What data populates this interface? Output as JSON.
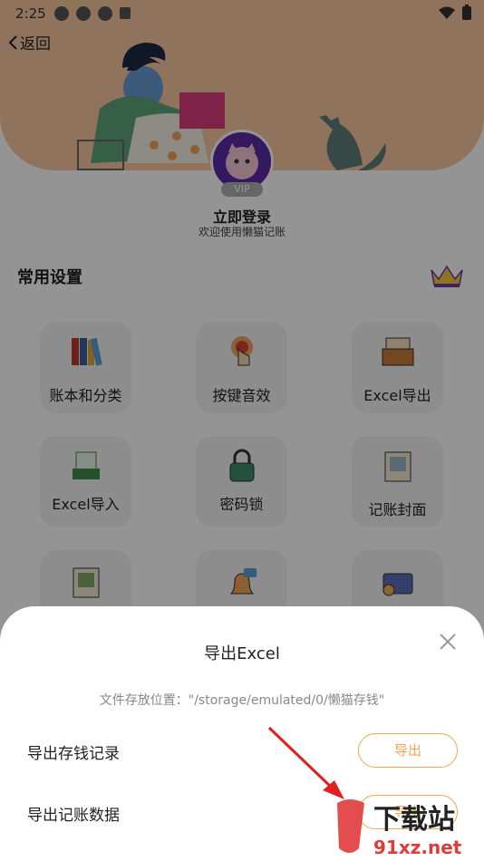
{
  "status_bar": {
    "time": "2:25"
  },
  "header": {
    "back_label": "返回"
  },
  "profile": {
    "vip_badge": "VIP",
    "login_title": "立即登录",
    "login_subtitle": "欢迎使用懒猫记账"
  },
  "settings": {
    "section_title": "常用设置",
    "items": [
      {
        "label": "账本和分类",
        "icon": "books-icon"
      },
      {
        "label": "按键音效",
        "icon": "touch-sound-icon"
      },
      {
        "label": "Excel导出",
        "icon": "export-drawer-icon"
      },
      {
        "label": "Excel导入",
        "icon": "xls-import-icon"
      },
      {
        "label": "密码锁",
        "icon": "padlock-icon"
      },
      {
        "label": "记账封面",
        "icon": "picture-frame-icon"
      }
    ]
  },
  "sheet": {
    "title": "导出Excel",
    "path_text": "文件存放位置：\"/storage/emulated/0/懒猫存钱\"",
    "rows": [
      {
        "label": "导出存钱记录",
        "button": "导出"
      },
      {
        "label": "导出记账数据",
        "button": "导出"
      }
    ]
  },
  "watermark": {
    "brand": "下载站",
    "site": "91xz.net"
  },
  "colors": {
    "accent": "#f3a552",
    "header": "#f9c6a0",
    "arrow": "#e02020"
  }
}
